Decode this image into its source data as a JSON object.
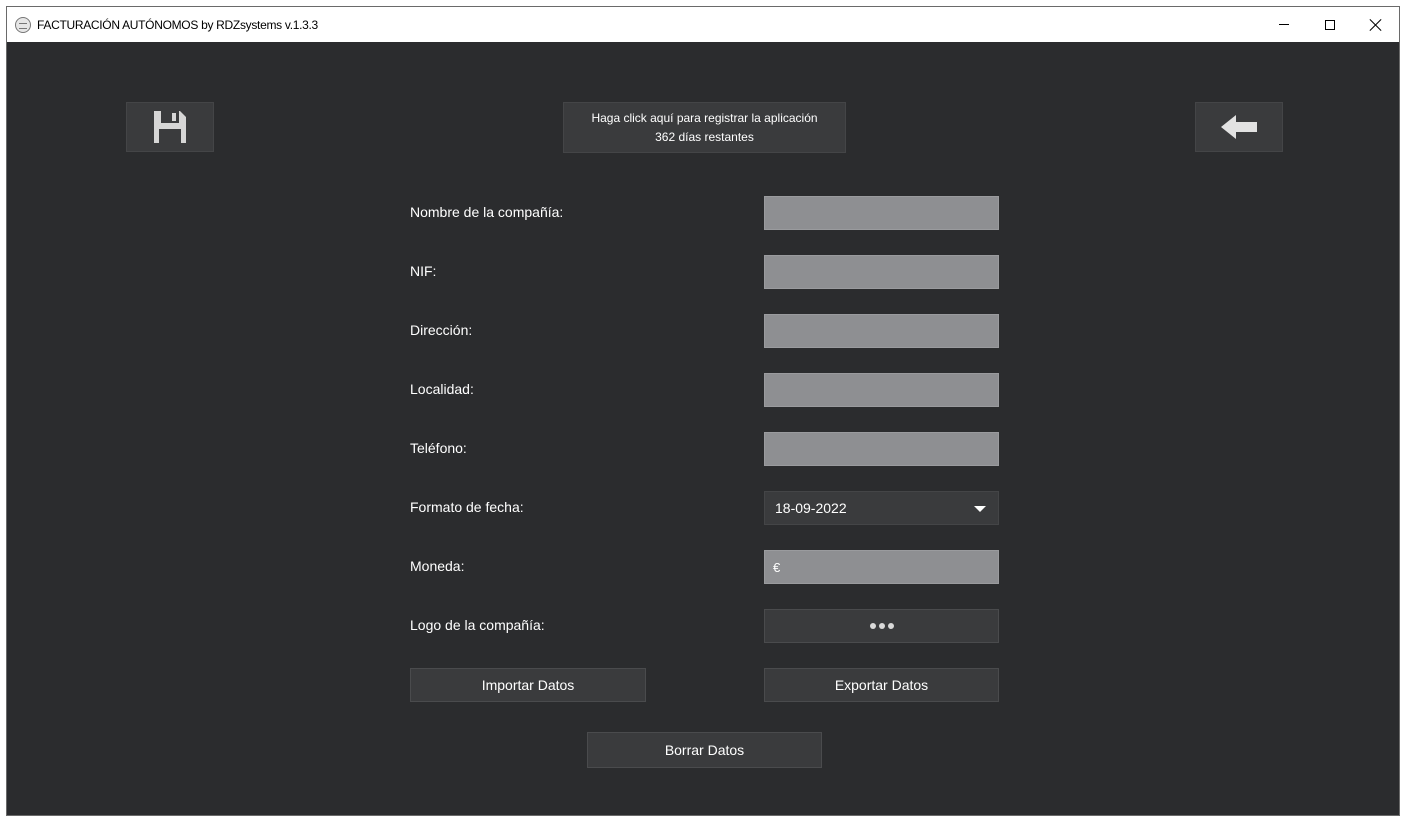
{
  "window": {
    "title": "FACTURACIÓN AUTÓNOMOS by RDZsystems v.1.3.3",
    "controls": [
      "minimize-icon",
      "maximize-icon",
      "close-icon"
    ]
  },
  "toolbar": {
    "save_icon": "floppy-disk-icon",
    "back_icon": "arrow-left-icon",
    "register_line1": "Haga click aquí para registrar la aplicación",
    "register_line2": "362 días restantes"
  },
  "form": {
    "company_name": {
      "label": "Nombre de la compañía:",
      "value": ""
    },
    "nif": {
      "label": "NIF:",
      "value": ""
    },
    "address": {
      "label": "Dirección:",
      "value": ""
    },
    "locality": {
      "label": "Localidad:",
      "value": ""
    },
    "phone": {
      "label": "Teléfono:",
      "value": ""
    },
    "date_format": {
      "label": "Formato de fecha:",
      "value": "18-09-2022"
    },
    "currency": {
      "label": "Moneda:",
      "value": "€"
    },
    "logo": {
      "label": "Logo de la compañía:"
    }
  },
  "actions": {
    "import": "Importar Datos",
    "export": "Exportar Datos",
    "delete": "Borrar Datos"
  },
  "colors": {
    "background": "#2b2c2e",
    "button": "#3a3b3d",
    "field": "#8e8f92",
    "text": "#ffffff"
  }
}
